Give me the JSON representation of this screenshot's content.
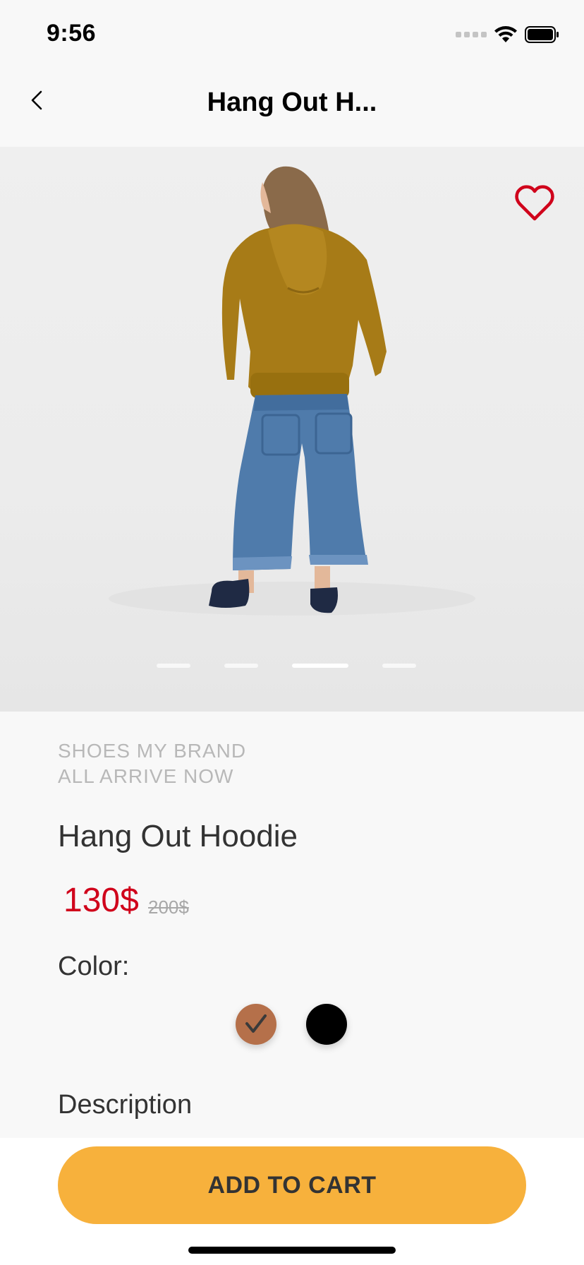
{
  "status_bar": {
    "time": "9:56"
  },
  "nav": {
    "title": "Hang Out H..."
  },
  "gallery": {
    "page_count": 4,
    "active_page": 3,
    "favorite_color": "#d0021b"
  },
  "product": {
    "brand_line_1": "SHOES MY BRAND",
    "brand_line_2": "ALL ARRIVE NOW",
    "name": "Hang Out Hoodie",
    "price": "130$",
    "old_price": "200$",
    "color_label": "Color:",
    "colors": [
      {
        "name": "brown",
        "hex": "#b5704a",
        "selected": true
      },
      {
        "name": "black",
        "hex": "#000000",
        "selected": false
      }
    ],
    "description_label": "Description"
  },
  "cart": {
    "button_label": "ADD TO CART",
    "button_color": "#f7b13c"
  }
}
